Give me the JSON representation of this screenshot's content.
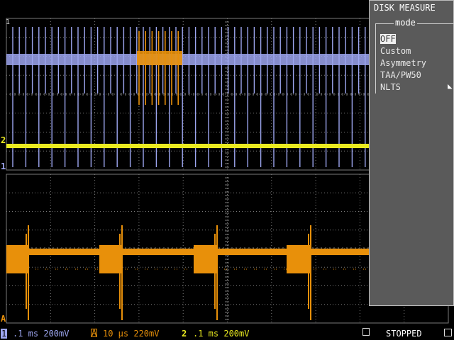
{
  "panel": {
    "title": "DISK MEASURE",
    "mode_label": "mode",
    "items": [
      "OFF",
      "Custom",
      "Asymmetry",
      "TAA/PW50",
      "NLTS"
    ],
    "selected": "OFF"
  },
  "markers": {
    "ch1_top": "1",
    "ch2": "2",
    "ch1_bottom": "1",
    "chA": "A"
  },
  "status": {
    "ch1_badge": "1",
    "ch1_settings": ".1 ms 200mV",
    "chA_badge": "A",
    "chA_settings": "10 μs 220mV",
    "ch2_badge": "2",
    "ch2_settings": ".1 ms 200mV",
    "state": "STOPPED"
  },
  "colors": {
    "ch1": "#9da6f0",
    "zoom": "#e8900a",
    "ch2": "#eaea20",
    "grid": "#7a7a7a",
    "panel": "#5a5a5a"
  }
}
